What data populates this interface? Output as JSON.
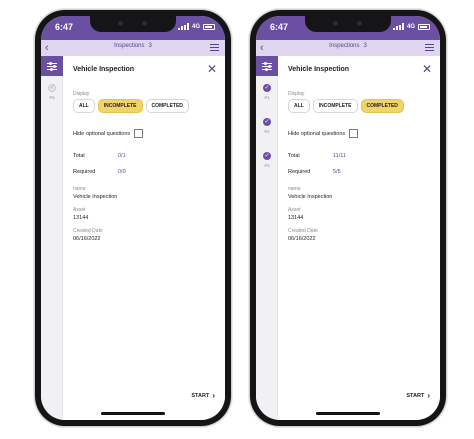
{
  "phones": [
    {
      "status": {
        "time": "6:47",
        "network": "4G"
      },
      "header": {
        "back_icon": "chevron-left-icon",
        "title": "Inspections",
        "count": "3",
        "menu_icon": "hamburger-menu-icon"
      },
      "rail": {
        "filter_icon": "sliders-icon",
        "items": [
          {
            "state": "pending",
            "label": "P3"
          }
        ]
      },
      "sheet": {
        "title": "Vehicle Inspection",
        "close_icon": "close-icon",
        "display_label": "Display",
        "filters": [
          {
            "label": "ALL",
            "active": false
          },
          {
            "label": "INCOMPLETE",
            "active": true
          },
          {
            "label": "COMPLETED",
            "active": false
          }
        ],
        "hide_optional_label": "Hide optional questions",
        "hide_optional_checked": false,
        "total_label": "Total",
        "total_value": "0/1",
        "required_label": "Required",
        "required_value": "0/0",
        "name_label": "name",
        "name_value": "Vehicle Inspection",
        "asset_label": "Asset",
        "asset_value": "13144",
        "created_label": "Created Date",
        "created_value": "06/16/2022",
        "start_label": "START"
      }
    },
    {
      "status": {
        "time": "6:47",
        "network": "4G"
      },
      "header": {
        "back_icon": "chevron-left-icon",
        "title": "Inspections",
        "count": "3",
        "menu_icon": "hamburger-menu-icon"
      },
      "rail": {
        "filter_icon": "sliders-icon",
        "items": [
          {
            "state": "done",
            "label": "P1"
          },
          {
            "state": "done",
            "label": "P2"
          },
          {
            "state": "done",
            "label": "P3"
          }
        ]
      },
      "sheet": {
        "title": "Vehicle Inspection",
        "close_icon": "close-icon",
        "display_label": "Display",
        "filters": [
          {
            "label": "ALL",
            "active": false
          },
          {
            "label": "INCOMPLETE",
            "active": false
          },
          {
            "label": "COMPLETED",
            "active": true
          }
        ],
        "hide_optional_label": "Hide optional questions",
        "hide_optional_checked": false,
        "total_label": "Total",
        "total_value": "11/11",
        "required_label": "Required",
        "required_value": "5/5",
        "name_label": "name",
        "name_value": "Vehicle Inspection",
        "asset_label": "Asset",
        "asset_value": "13144",
        "created_label": "Created Date",
        "created_value": "06/16/2022",
        "start_label": "START"
      }
    }
  ],
  "colors": {
    "brand_purple": "#6b4fa3",
    "header_lavender": "#ded6ef",
    "active_chip_yellow": "#f0d46a",
    "value_purple": "#5b3f94"
  }
}
